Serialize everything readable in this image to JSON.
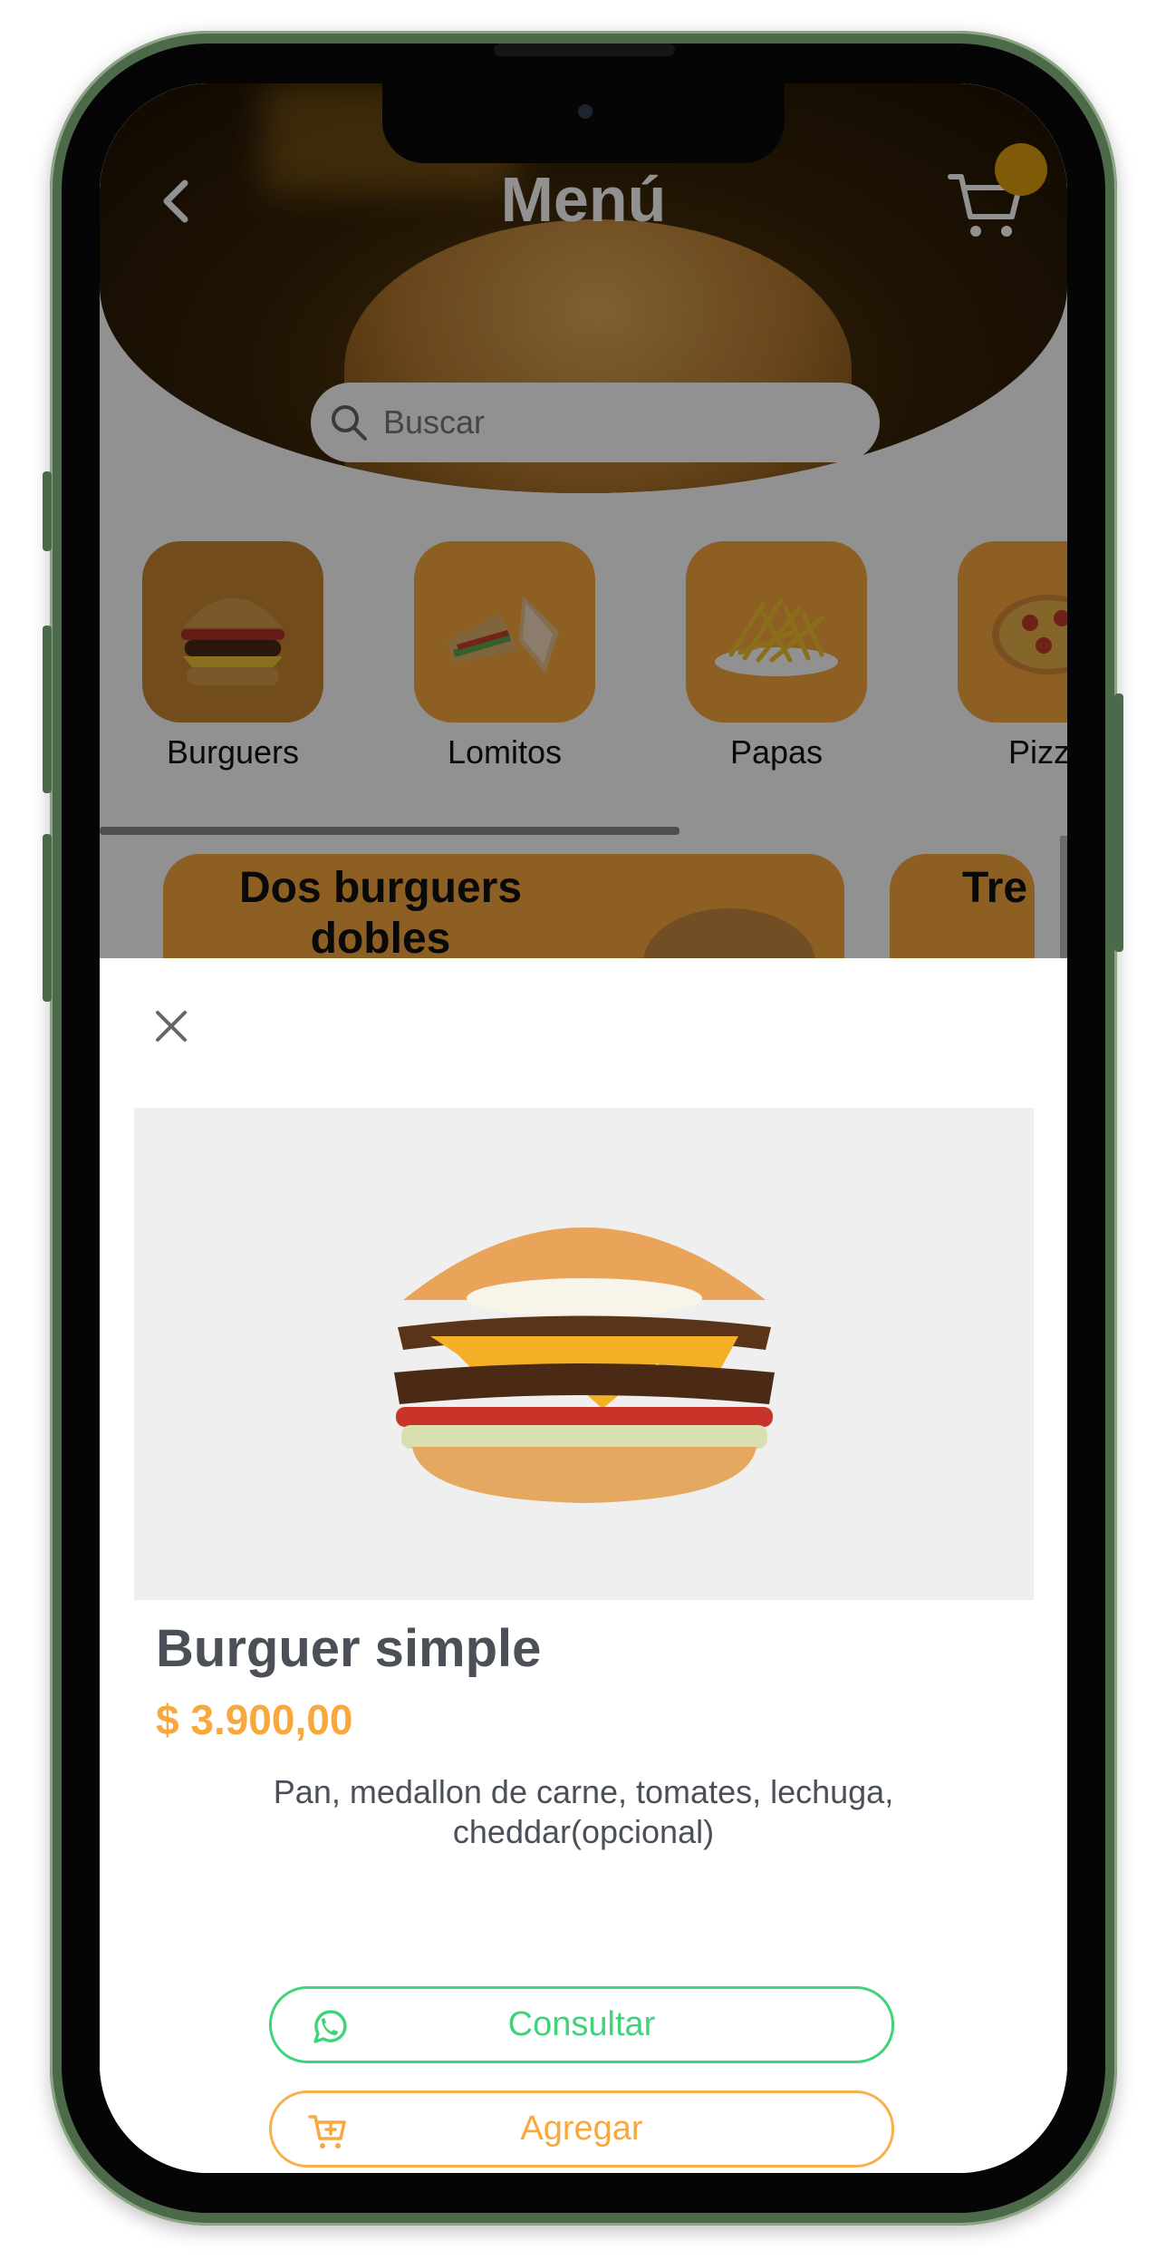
{
  "header": {
    "title": "Menú",
    "back_icon": "chevron-left-icon",
    "cart_icon": "cart-icon"
  },
  "search": {
    "placeholder": "Buscar"
  },
  "categories": [
    {
      "label": "Burguers",
      "icon": "burger-icon",
      "selected": true
    },
    {
      "label": "Lomitos",
      "icon": "sandwich-icon",
      "selected": false
    },
    {
      "label": "Papas",
      "icon": "fries-icon",
      "selected": false
    },
    {
      "label": "Pizza",
      "icon": "pizza-icon",
      "selected": false
    }
  ],
  "promos": [
    {
      "title": "Dos burguers dobles"
    },
    {
      "title": "Tre"
    }
  ],
  "product": {
    "name": "Burguer simple",
    "price": "$ 3.900,00",
    "description": "Pan, medallon de carne, tomates, lechuga, cheddar(opcional)",
    "image_icon": "burger-photo"
  },
  "actions": {
    "consult_label": "Consultar",
    "add_label": "Agregar"
  },
  "colors": {
    "accent_orange": "#f8a83c",
    "whatsapp_green": "#3fd37a",
    "badge_gold": "#e0a10f",
    "text_gray": "#4b4f57"
  }
}
